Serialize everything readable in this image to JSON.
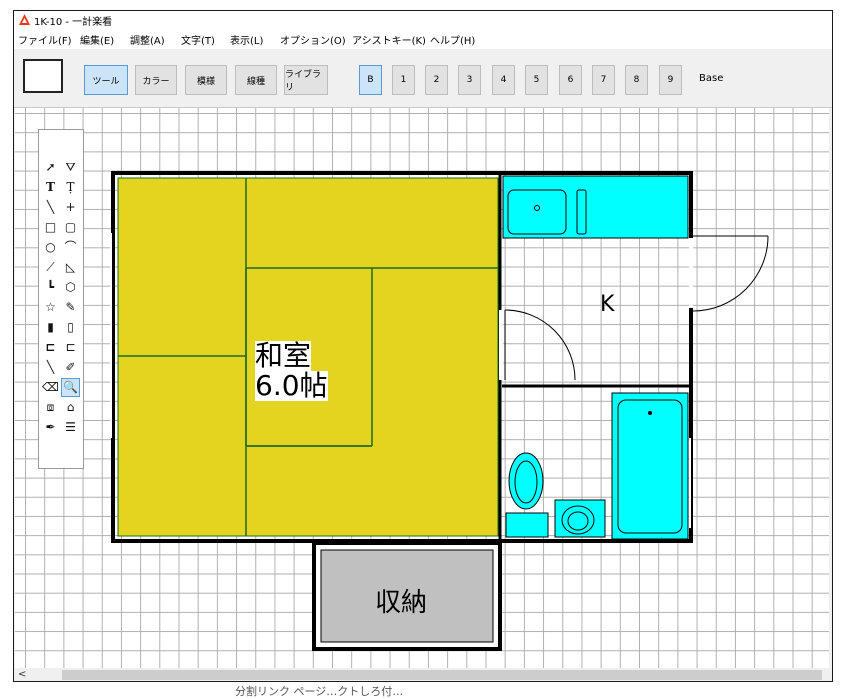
{
  "window": {
    "title": "1K-10 - 一計楽看"
  },
  "menu": [
    "ファイル(F)",
    "編集(E)",
    "調整(A)",
    "文字(T)",
    "表示(L)",
    "オプション(O)",
    "アシストキー(K)",
    "ヘルプ(H)"
  ],
  "toolbar": {
    "tabs": [
      "ツール",
      "カラー",
      "模様",
      "線種",
      "ライブラリ"
    ],
    "layers": [
      "B",
      "1",
      "2",
      "3",
      "4",
      "5",
      "6",
      "7",
      "8",
      "9"
    ],
    "base_label": "Base"
  },
  "plan": {
    "room_name": "和室",
    "room_size": "6.0帖",
    "kitchen_label": "K",
    "storage_label": "収納",
    "colors": {
      "tatami": "#e3d41f",
      "fixture": "#00ffff",
      "storage": "#c0c0c0",
      "tatami_line": "#1e6b1e"
    }
  },
  "scroll": {
    "left_arrow": "<"
  },
  "caption": "分割リンク ページ…クトしろ付…"
}
